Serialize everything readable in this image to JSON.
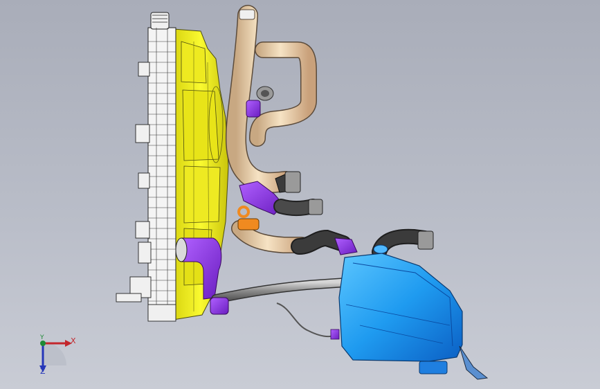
{
  "viewport": {
    "background_top": "#a9adb9",
    "background_bottom": "#c9ccd5"
  },
  "components": {
    "radiator": {
      "color": "#f4f4f4",
      "outline": "#222222"
    },
    "fan_shroud": {
      "color": "#f2ee1c",
      "outline": "#4a4a10"
    },
    "coolant_hoses": {
      "color": "#f3d9b3",
      "outline": "#5a4a3a"
    },
    "hose_clamps": {
      "color": "#8a2be2",
      "outline": "#3a0a60"
    },
    "rubber_sleeves": {
      "color": "#3b3b3b"
    },
    "expansion_tank": {
      "color": "#1f9bf0",
      "outline": "#0a3a70"
    },
    "metal_pipe": {
      "color": "#9a9a9a"
    },
    "orange_clip": {
      "color": "#f08a20"
    }
  },
  "triad": {
    "x_label": "X",
    "y_label": "Y",
    "z_label": "Z",
    "x_color": "#c3262c",
    "y_color": "#1f8a36",
    "z_color": "#2536b8"
  }
}
